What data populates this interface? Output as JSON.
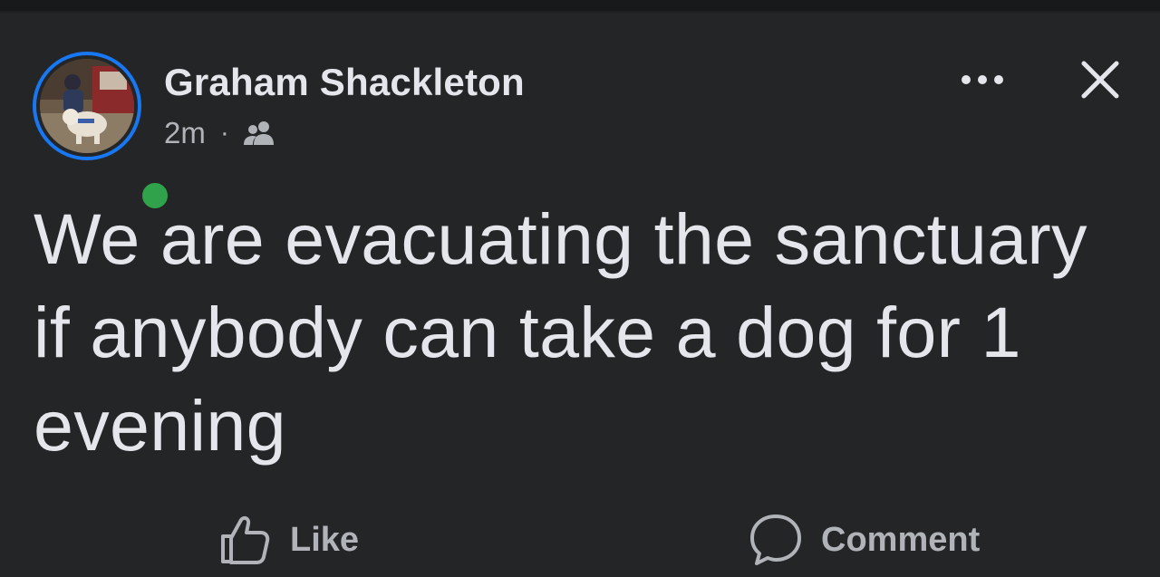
{
  "post": {
    "author_name": "Graham Shackleton",
    "time": "2m",
    "separator": "·",
    "audience_icon": "friends-icon",
    "text": "We are evacuating the sanctuary if anybody can take a dog for 1 evening",
    "author_online": true
  },
  "header_actions": {
    "more_icon": "more-options-icon",
    "close_icon": "close-icon"
  },
  "actions": {
    "like_label": "Like",
    "like_icon": "thumbs-up-icon",
    "comment_label": "Comment",
    "comment_icon": "speech-bubble-icon"
  },
  "colors": {
    "background": "#242526",
    "text_primary": "#e4e6eb",
    "text_secondary": "#b0b3b8",
    "story_ring": "#1877f2",
    "online_dot": "#31a24c"
  }
}
